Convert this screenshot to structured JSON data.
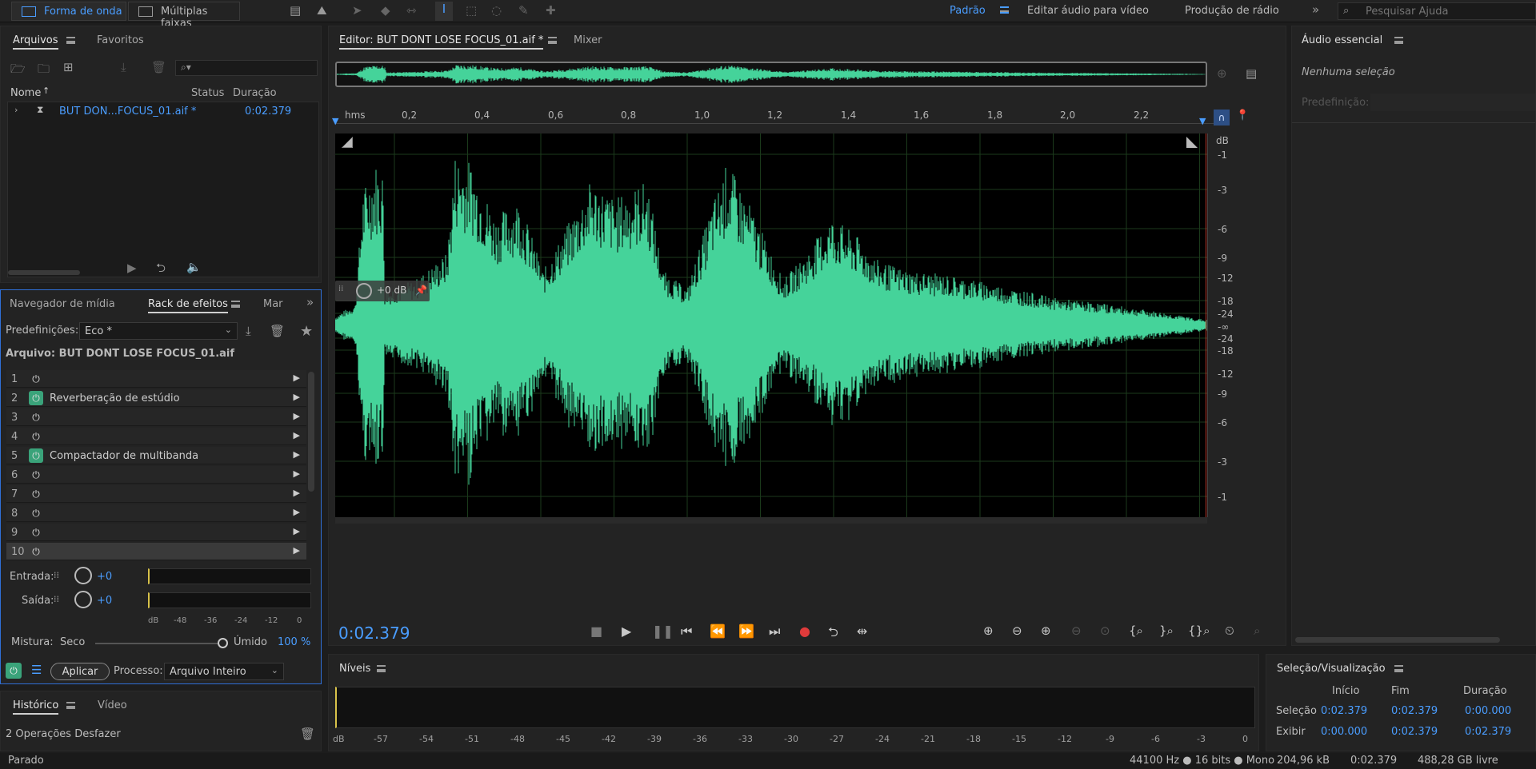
{
  "topbar": {
    "mode_waveform": "Forma de onda",
    "mode_multitrack": "Múltiplas faixas",
    "workspaces": [
      "Padrão",
      "Editar áudio para vídeo",
      "Produção de rádio"
    ],
    "search_placeholder": "Pesquisar Ajuda"
  },
  "files": {
    "tab_files": "Arquivos",
    "tab_favorites": "Favoritos",
    "col_name": "Nome",
    "col_status": "Status",
    "col_duration": "Duração",
    "file_name": "BUT DON...FOCUS_01.aif *",
    "file_duration": "0:02.379"
  },
  "effects": {
    "tab_media": "Navegador de mídia",
    "tab_rack": "Rack de efeitos",
    "tab_mar": "Mar",
    "presets_label": "Predefinições:",
    "preset_value": "Eco *",
    "file_label": "Arquivo: BUT DONT LOSE FOCUS_01.aif",
    "slots": [
      {
        "n": "1",
        "name": ""
      },
      {
        "n": "2",
        "name": "Reverberação de estúdio"
      },
      {
        "n": "3",
        "name": ""
      },
      {
        "n": "4",
        "name": ""
      },
      {
        "n": "5",
        "name": "Compactador de multibanda"
      },
      {
        "n": "6",
        "name": ""
      },
      {
        "n": "7",
        "name": ""
      },
      {
        "n": "8",
        "name": ""
      },
      {
        "n": "9",
        "name": ""
      },
      {
        "n": "10",
        "name": ""
      }
    ],
    "input_label": "Entrada:",
    "output_label": "Saída:",
    "input_value": "+0",
    "output_value": "+0",
    "meter_ticks": [
      "dB",
      "-48",
      "-36",
      "-24",
      "-12",
      "0"
    ],
    "mix_label": "Mistura:",
    "dry_label": "Seco",
    "wet_label": "Úmido",
    "wet_value": "100 %",
    "apply_label": "Aplicar",
    "process_label": "Processo:",
    "process_value": "Arquivo Inteiro"
  },
  "history": {
    "tab_history": "Histórico",
    "tab_video": "Vídeo",
    "ops_text": "2 Operações Desfazer"
  },
  "status_bar": {
    "state": "Parado",
    "format": "44100 Hz ● 16 bits ● Mono",
    "size": "204,96 kB",
    "duration": "0:02.379",
    "free": "488,28 GB livre"
  },
  "editor": {
    "tab_editor": "Editor: BUT DONT LOSE FOCUS_01.aif *",
    "tab_mixer": "Mixer",
    "ruler_unit": "hms",
    "ruler_ticks": [
      "0,2",
      "0,4",
      "0,6",
      "0,8",
      "1,0",
      "1,2",
      "1,4",
      "1,6",
      "1,8",
      "2,0",
      "2,2"
    ],
    "db_label": "dB",
    "db_ticks": [
      "-1",
      "-3",
      "-6",
      "-9",
      "-12",
      "-18",
      "-24",
      "-∞",
      "-24",
      "-18",
      "-12",
      "-9",
      "-6",
      "-3",
      "-1"
    ],
    "gain_value": "+0 dB",
    "timecode": "0:02.379",
    "waveform_color": "#45d39a"
  },
  "essential": {
    "title": "Áudio essencial",
    "no_selection": "Nenhuma seleção",
    "preset_label": "Predefinição:"
  },
  "levels": {
    "title": "Níveis",
    "ticks": [
      "dB",
      "-57",
      "-54",
      "-51",
      "-48",
      "-45",
      "-42",
      "-39",
      "-36",
      "-33",
      "-30",
      "-27",
      "-24",
      "-21",
      "-18",
      "-15",
      "-12",
      "-9",
      "-6",
      "-3",
      "0"
    ]
  },
  "selection": {
    "title": "Seleção/Visualização",
    "col_start": "Início",
    "col_end": "Fim",
    "col_duration": "Duração",
    "row_selection": "Seleção",
    "row_view": "Exibir",
    "sel_start": "0:02.379",
    "sel_end": "0:02.379",
    "sel_duration": "0:00.000",
    "view_start": "0:00.000",
    "view_end": "0:02.379",
    "view_duration": "0:02.379"
  }
}
